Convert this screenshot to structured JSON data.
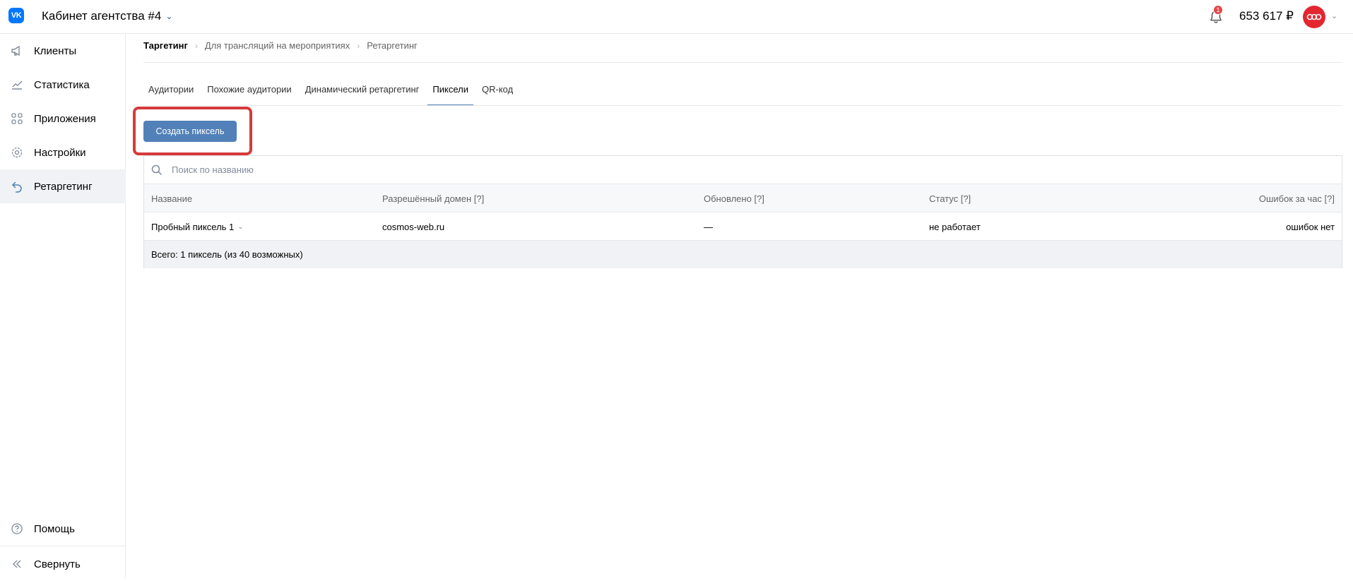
{
  "header": {
    "logo_text": "VK",
    "cabinet_title": "Кабинет агентства #4",
    "notification_count": "1",
    "balance": "653 617 ₽"
  },
  "sidebar": {
    "items": [
      {
        "label": "Клиенты",
        "icon": "megaphone-icon"
      },
      {
        "label": "Статистика",
        "icon": "chart-line-icon"
      },
      {
        "label": "Приложения",
        "icon": "apps-grid-icon"
      },
      {
        "label": "Настройки",
        "icon": "gear-icon"
      },
      {
        "label": "Ретаргетинг",
        "icon": "retarget-arrow-icon",
        "active": true
      }
    ],
    "help_label": "Помощь",
    "collapse_label": "Свернуть"
  },
  "breadcrumb": [
    "Таргетинг",
    "Для трансляций на мероприятиях",
    "Ретаргетинг"
  ],
  "tabs": [
    {
      "label": "Аудитории"
    },
    {
      "label": "Похожие аудитории"
    },
    {
      "label": "Динамический ретаргетинг"
    },
    {
      "label": "Пиксели",
      "active": true
    },
    {
      "label": "QR-код"
    }
  ],
  "create_button_label": "Создать пиксель",
  "search": {
    "placeholder": "Поиск по названию"
  },
  "table": {
    "columns": [
      "Название",
      "Разрешённый домен [?]",
      "Обновлено [?]",
      "Статус [?]",
      "Ошибок за час [?]"
    ],
    "rows": [
      {
        "name": "Пробный пиксель 1",
        "domain": "cosmos-web.ru",
        "updated": "—",
        "status": "не работает",
        "errors": "ошибок нет"
      }
    ],
    "footer": "Всего: 1 пиксель (из 40 возможных)"
  },
  "colors": {
    "accent": "#5181b8",
    "highlight": "#d63a3a",
    "badge": "#e64646",
    "avatar": "#e3262f"
  }
}
